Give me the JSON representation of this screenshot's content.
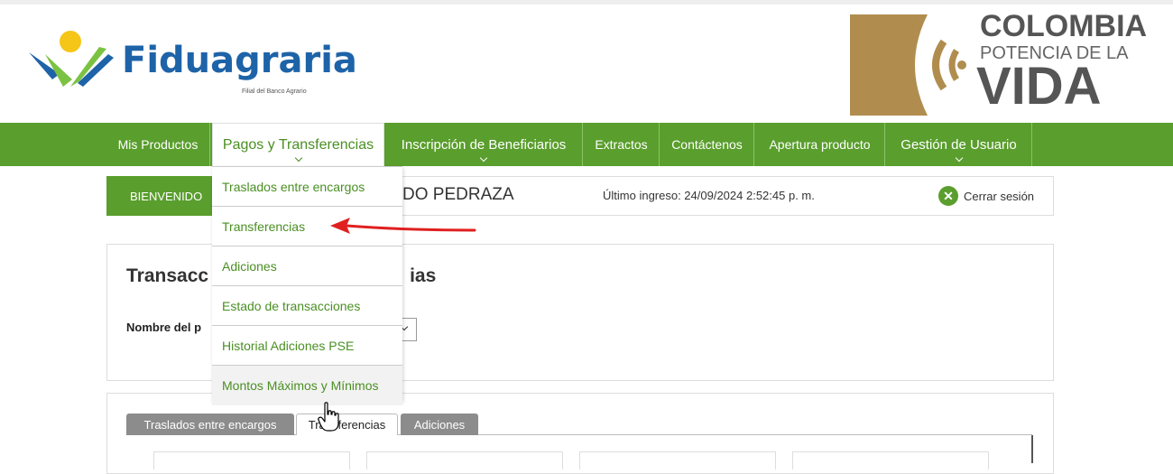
{
  "brand": {
    "name": "Fiduagraria",
    "tagline": "Filial del Banco Agrario",
    "colors": {
      "blue": "#1e63a8",
      "green": "#5a9e2d",
      "yellow": "#f5c518"
    }
  },
  "government": {
    "line1": "COLOMBIA",
    "line2": "POTENCIA DE LA",
    "line3": "VIDA",
    "mark_color": "#b08d4f"
  },
  "nav": {
    "items": [
      {
        "label": "Mis Productos",
        "has_chevron": false
      },
      {
        "label": "Pagos y Transferencias",
        "has_chevron": true,
        "active": true
      },
      {
        "label": "Inscripción de Beneficiarios",
        "has_chevron": true
      },
      {
        "label": "Extractos",
        "has_chevron": false
      },
      {
        "label": "Contáctenos",
        "has_chevron": false
      },
      {
        "label": "Apertura producto",
        "has_chevron": false
      },
      {
        "label": "Gestión de Usuario",
        "has_chevron": true
      }
    ]
  },
  "dropdown": {
    "items": [
      {
        "label": "Traslados entre encargos"
      },
      {
        "label": "Transferencias"
      },
      {
        "label": "Adiciones"
      },
      {
        "label": "Estado de transacciones"
      },
      {
        "label": "Historial Adiciones PSE"
      },
      {
        "label": "Montos Máximos y Mínimos",
        "hovered": true
      }
    ]
  },
  "session": {
    "welcome_label": "BIENVENIDO",
    "user_name_visible": "DO PEDRAZA",
    "last_login": "Último ingreso: 24/09/2024 2:52:45 p. m.",
    "logout_label": "Cerrar sesión"
  },
  "transactions": {
    "title_left": "Transacc",
    "title_right": "ias",
    "product_label": "Nombre del p"
  },
  "tabs": [
    {
      "label": "Traslados entre encargos"
    },
    {
      "label": "Transferencias",
      "selected": true
    },
    {
      "label": "Adiciones"
    }
  ],
  "annotation": {
    "color": "#e02020"
  }
}
